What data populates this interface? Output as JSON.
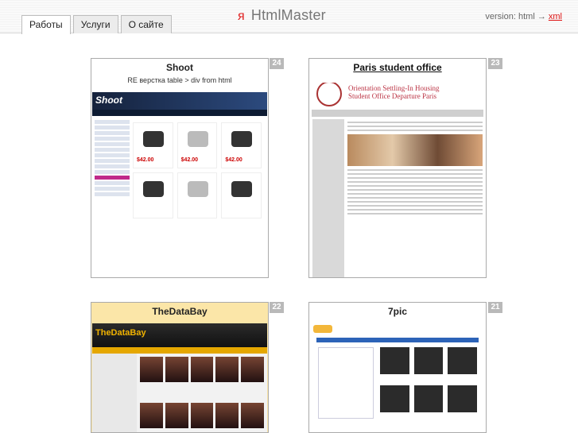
{
  "header": {
    "tabs": [
      {
        "label": "Работы",
        "active": true
      },
      {
        "label": "Услуги",
        "active": false
      },
      {
        "label": "О сайте",
        "active": false
      }
    ],
    "logo_glyph": "я",
    "logo_text": "HtmlMaster",
    "version_prefix": "version: html →",
    "version_link": "xml"
  },
  "works": [
    {
      "number": "24",
      "title": "Shoot",
      "subtitle": "RE верстка table > div from html",
      "thumb": "shoot",
      "shoot_logo": "Shoot",
      "price": "$42.00"
    },
    {
      "number": "23",
      "title": "Paris student office",
      "thumb": "paris",
      "paris_lines": [
        "Orientation Settling-In Housing",
        "Student Office Departure Paris"
      ]
    },
    {
      "number": "22",
      "title": "TheDataBay",
      "thumb": "databay",
      "db_logo": "TheDataBay"
    },
    {
      "number": "21",
      "title": "7pic",
      "thumb": "7pic"
    }
  ],
  "colors": {
    "accent": "#e02020",
    "tab_border": "#bdbdbd",
    "badge": "#b9b9b9"
  }
}
